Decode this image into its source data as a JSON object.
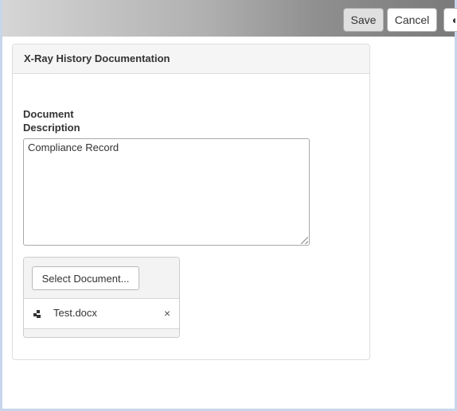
{
  "toolbar": {
    "save_label": "Save",
    "cancel_label": "Cancel",
    "extra_label": "◖"
  },
  "panel": {
    "title": "X-Ray History Documentation"
  },
  "form": {
    "description_label_line1": "Document",
    "description_label_line2": "Description",
    "description_value": "Compliance Record"
  },
  "upload": {
    "select_label": "Select Document...",
    "files": [
      {
        "name": "Test.docx"
      }
    ],
    "remove_glyph": "×"
  },
  "colors": {
    "frame_border": "#c8d6ec",
    "panel_heading_bg": "#f5f5f5",
    "save_button_bg": "#e0e0e0"
  },
  "icons": {
    "file": "file-type-icon",
    "remove": "close-icon"
  }
}
